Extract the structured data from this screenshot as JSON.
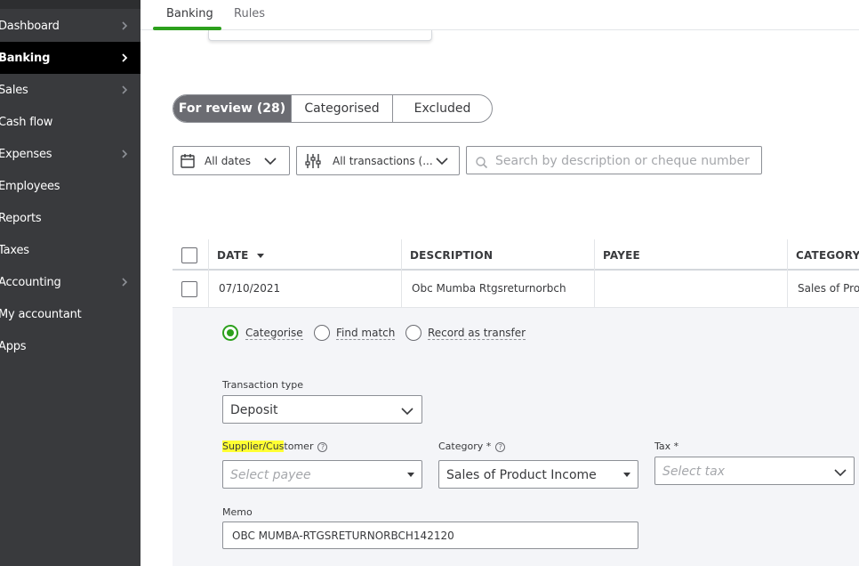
{
  "sidebar": {
    "items": [
      {
        "label": "Dashboard",
        "chevron": true,
        "active": false
      },
      {
        "label": "Banking",
        "chevron": true,
        "active": true
      },
      {
        "label": "Sales",
        "chevron": true,
        "active": false
      },
      {
        "label": "Cash flow",
        "chevron": false,
        "active": false
      },
      {
        "label": "Expenses",
        "chevron": true,
        "active": false
      },
      {
        "label": "Employees",
        "chevron": false,
        "active": false
      },
      {
        "label": "Reports",
        "chevron": false,
        "active": false
      },
      {
        "label": "Taxes",
        "chevron": false,
        "active": false
      },
      {
        "label": "Accounting",
        "chevron": true,
        "active": false
      },
      {
        "label": "My accountant",
        "chevron": false,
        "active": false
      },
      {
        "label": "Apps",
        "chevron": false,
        "active": false
      }
    ]
  },
  "tabs": {
    "banking": "Banking",
    "rules": "Rules"
  },
  "segmented": {
    "for_review": "For review (28)",
    "categorised": "Categorised",
    "excluded": "Excluded"
  },
  "filters": {
    "dates": "All dates",
    "transactions": "All transactions (...",
    "search_placeholder": "Search by description or cheque number"
  },
  "table": {
    "columns": {
      "date": "DATE",
      "description": "DESCRIPTION",
      "payee": "PAYEE",
      "category": "CATEGORY"
    },
    "row": {
      "date": "07/10/2021",
      "description": "Obc Mumba Rtgsreturnorbch",
      "payee": "",
      "category": "Sales of Prod"
    }
  },
  "detail": {
    "radios": {
      "categorise": "Categorise",
      "find_match": "Find match",
      "record_transfer": "Record as transfer"
    },
    "transaction_type_label": "Transaction type",
    "transaction_type_value": "Deposit",
    "supplier_label_highlight": "Supplier/Cus",
    "supplier_label_rest": "tomer",
    "supplier_placeholder": "Select payee",
    "category_label": "Category *",
    "category_value": "Sales of Product Income",
    "tax_label": "Tax *",
    "tax_placeholder": "Select tax",
    "memo_label": "Memo",
    "memo_value": "OBC  MUMBA-RTGSRETURNORBCH142120"
  },
  "colors": {
    "sidebar_bg": "#393a3d",
    "accent_green": "#2ca01c",
    "highlight": "#ffff33"
  }
}
